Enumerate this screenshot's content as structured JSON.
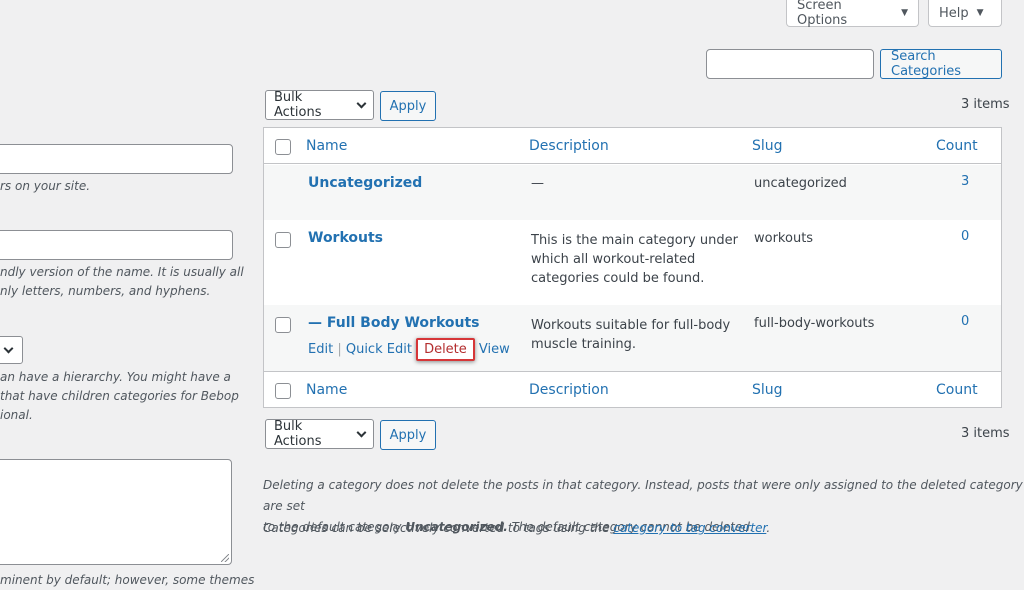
{
  "top": {
    "screen_options": "Screen Options",
    "help": "Help"
  },
  "search": {
    "button": "Search Categories",
    "value": ""
  },
  "bulk_top": {
    "select": "Bulk Actions",
    "apply": "Apply",
    "items": "3 items"
  },
  "bulk_bottom": {
    "select": "Bulk Actions",
    "apply": "Apply",
    "items": "3 items"
  },
  "table": {
    "headers": {
      "name": "Name",
      "description": "Description",
      "slug": "Slug",
      "count": "Count"
    },
    "rows": [
      {
        "name": "Uncategorized",
        "description": "—",
        "slug": "uncategorized",
        "count": "3"
      },
      {
        "name": "Workouts",
        "description_lines": [
          "This is the main category under",
          "which all workout-related",
          "categories could be found."
        ],
        "slug": "workouts",
        "count": "0"
      },
      {
        "name": "— Full Body Workouts",
        "description_lines": [
          "Workouts suitable for full-body",
          "muscle training."
        ],
        "slug": "full-body-workouts",
        "count": "0",
        "actions": {
          "edit": "Edit",
          "quick_edit": "Quick Edit",
          "delete": "Delete",
          "view": "View"
        }
      }
    ]
  },
  "left_form": {
    "help1": "rs on your site.",
    "help2_lines": [
      "ndly version of the name. It is usually all",
      "nly letters, numbers, and hyphens."
    ],
    "help3_lines": [
      "an have a hierarchy. You might have a",
      "that have children categories for Bebop",
      "ional."
    ],
    "help4": "minent by default; however, some themes"
  },
  "notes": {
    "line1": "Deleting a category does not delete the posts in that category. Instead, posts that were only assigned to the deleted category are set",
    "line2_pre": "to the default category ",
    "line2_bold": "Uncategorized.",
    "line2_post": " The default category cannot be deleted.",
    "line3_pre": "Categories can be selectively converted to tags using the ",
    "line3_link": "category to tag converter",
    "line3_post": "."
  }
}
